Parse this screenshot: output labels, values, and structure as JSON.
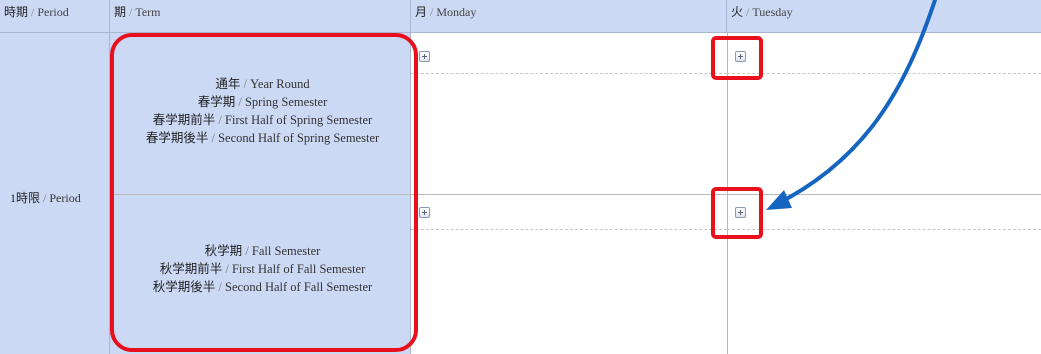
{
  "header": {
    "col_period": {
      "ja": "時期",
      "en": "Period"
    },
    "col_term": {
      "ja": "期",
      "en": "Term"
    },
    "col_monday": {
      "ja": "月",
      "en": "Monday"
    },
    "col_tuesday": {
      "ja": "火",
      "en": "Tuesday"
    }
  },
  "row": {
    "period_label": {
      "ja": "1時限",
      "en": "Period"
    }
  },
  "terms_upper": [
    {
      "ja": "通年",
      "en": "Year Round"
    },
    {
      "ja": "春学期",
      "en": "Spring Semester"
    },
    {
      "ja": "春学期前半",
      "en": "First Half of Spring Semester"
    },
    {
      "ja": "春学期後半",
      "en": "Second Half of Spring Semester"
    }
  ],
  "terms_lower": [
    {
      "ja": "秋学期",
      "en": "Fall Semester"
    },
    {
      "ja": "秋学期前半",
      "en": "First Half of Fall Semester"
    },
    {
      "ja": "秋学期後半",
      "en": "Second Half of Fall Semester"
    }
  ],
  "separator": "/",
  "colors": {
    "header_bg": "#ccd9f5",
    "highlight": "#e8101c",
    "arrow": "#1565c0"
  },
  "icons": {
    "add": "plus-square-icon",
    "arrow": "curved-arrow-icon"
  }
}
